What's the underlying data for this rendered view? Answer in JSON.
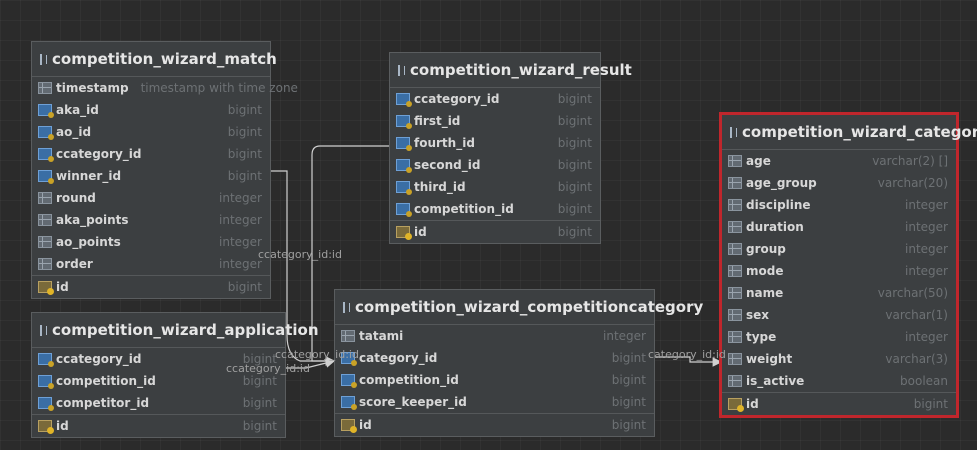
{
  "tables": {
    "match": {
      "name": "competition_wizard_match",
      "columns": [
        {
          "name": "timestamp",
          "type": "timestamp with time zone",
          "icon": "column-icon"
        },
        {
          "name": "aka_id",
          "type": "bigint",
          "icon": "foreign-key-icon"
        },
        {
          "name": "ao_id",
          "type": "bigint",
          "icon": "foreign-key-icon"
        },
        {
          "name": "ccategory_id",
          "type": "bigint",
          "icon": "foreign-key-icon"
        },
        {
          "name": "winner_id",
          "type": "bigint",
          "icon": "foreign-key-icon"
        },
        {
          "name": "round",
          "type": "integer",
          "icon": "column-icon"
        },
        {
          "name": "aka_points",
          "type": "integer",
          "icon": "column-icon"
        },
        {
          "name": "ao_points",
          "type": "integer",
          "icon": "column-icon"
        },
        {
          "name": "order",
          "type": "integer",
          "icon": "column-icon"
        }
      ],
      "pk": {
        "name": "id",
        "type": "bigint",
        "icon": "primary-key-icon"
      }
    },
    "result": {
      "name": "competition_wizard_result",
      "columns": [
        {
          "name": "ccategory_id",
          "type": "bigint",
          "icon": "foreign-key-icon"
        },
        {
          "name": "first_id",
          "type": "bigint",
          "icon": "foreign-key-icon"
        },
        {
          "name": "fourth_id",
          "type": "bigint",
          "icon": "foreign-key-icon"
        },
        {
          "name": "second_id",
          "type": "bigint",
          "icon": "foreign-key-icon"
        },
        {
          "name": "third_id",
          "type": "bigint",
          "icon": "foreign-key-icon"
        },
        {
          "name": "competition_id",
          "type": "bigint",
          "icon": "foreign-key-icon"
        }
      ],
      "pk": {
        "name": "id",
        "type": "bigint",
        "icon": "primary-key-icon"
      }
    },
    "category": {
      "name": "competition_wizard_category",
      "columns": [
        {
          "name": "age",
          "type": "varchar(2) []",
          "icon": "column-icon"
        },
        {
          "name": "age_group",
          "type": "varchar(20)",
          "icon": "column-icon"
        },
        {
          "name": "discipline",
          "type": "integer",
          "icon": "column-icon"
        },
        {
          "name": "duration",
          "type": "integer",
          "icon": "column-icon"
        },
        {
          "name": "group",
          "type": "integer",
          "icon": "column-icon"
        },
        {
          "name": "mode",
          "type": "integer",
          "icon": "column-icon"
        },
        {
          "name": "name",
          "type": "varchar(50)",
          "icon": "column-icon"
        },
        {
          "name": "sex",
          "type": "varchar(1)",
          "icon": "column-icon"
        },
        {
          "name": "type",
          "type": "integer",
          "icon": "column-icon"
        },
        {
          "name": "weight",
          "type": "varchar(3)",
          "icon": "column-icon"
        },
        {
          "name": "is_active",
          "type": "boolean",
          "icon": "column-icon"
        }
      ],
      "pk": {
        "name": "id",
        "type": "bigint",
        "icon": "primary-key-icon"
      }
    },
    "application": {
      "name": "competition_wizard_application",
      "columns": [
        {
          "name": "ccategory_id",
          "type": "bigint",
          "icon": "foreign-key-icon"
        },
        {
          "name": "competition_id",
          "type": "bigint",
          "icon": "foreign-key-icon"
        },
        {
          "name": "competitor_id",
          "type": "bigint",
          "icon": "foreign-key-icon"
        }
      ],
      "pk": {
        "name": "id",
        "type": "bigint",
        "icon": "primary-key-icon"
      }
    },
    "competitioncategory": {
      "name": "competition_wizard_competitioncategory",
      "columns": [
        {
          "name": "tatami",
          "type": "integer",
          "icon": "column-icon"
        },
        {
          "name": "category_id",
          "type": "bigint",
          "icon": "foreign-key-icon"
        },
        {
          "name": "competition_id",
          "type": "bigint",
          "icon": "foreign-key-icon"
        },
        {
          "name": "score_keeper_id",
          "type": "bigint",
          "icon": "foreign-key-icon"
        }
      ],
      "pk": {
        "name": "id",
        "type": "bigint",
        "icon": "primary-key-icon"
      }
    }
  },
  "edge_labels": {
    "match_ccategory": "ccategory_id:id",
    "application_ccategory_a": "ccategory_id:id",
    "application_ccategory_b": "ccategory_id:id",
    "category_link": "category_id:id"
  },
  "colors": {
    "background": "#2b2b2b",
    "table_bg": "#3c3f41",
    "selected_border": "#c0262c",
    "edge": "#d0d0d0"
  }
}
